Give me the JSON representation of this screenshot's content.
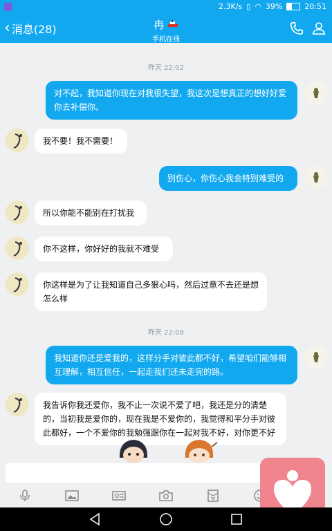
{
  "status_bar": {
    "net_speed": "2.3K/s",
    "battery_percent": "39%",
    "battery_level": 0.39,
    "time": "20:51"
  },
  "header": {
    "back_label": "消息(28)",
    "contact_name": "冉",
    "contact_status": "手机在线"
  },
  "messages": [
    {
      "kind": "time",
      "text": "昨天 22:02"
    },
    {
      "kind": "out",
      "text": "对不起，我知道你现在对我很失望，我这次是想真正的想好好爱你去补偿你。"
    },
    {
      "kind": "in",
      "text": "我不要！我不需要！"
    },
    {
      "kind": "out",
      "text": "别伤心，你伤心我会特别难受的"
    },
    {
      "kind": "in",
      "text": "所以你能不能别在打扰我"
    },
    {
      "kind": "in",
      "text": "你不这样，你好好的我就不难受"
    },
    {
      "kind": "in",
      "text": "你这样是为了让我知道自己多狠心吗，然后过意不去还是想怎么样"
    },
    {
      "kind": "time",
      "text": "昨天 22:08"
    },
    {
      "kind": "out",
      "text": "我知道你还是爱我的，这样分手对彼此都不好，希望咱们能够相互理解，相互信任，一起走我们还未走完的路。"
    },
    {
      "kind": "in",
      "text": "我告诉你我还爱你，我不止一次说不爱了吧，我还是分的清楚的，当初我是爱你的，现在我是不爱你的，我觉得和平分手对彼此都好，一个不爱你的我勉强跟你在一起对我不好，对你更不好"
    }
  ],
  "colors": {
    "accent": "#12a8f0",
    "floating_button": "#f0858f"
  },
  "toolbar": {
    "icons": [
      "microphone-icon",
      "image-icon",
      "video-icon",
      "camera-icon",
      "red-packet-icon",
      "emoji-icon"
    ]
  }
}
